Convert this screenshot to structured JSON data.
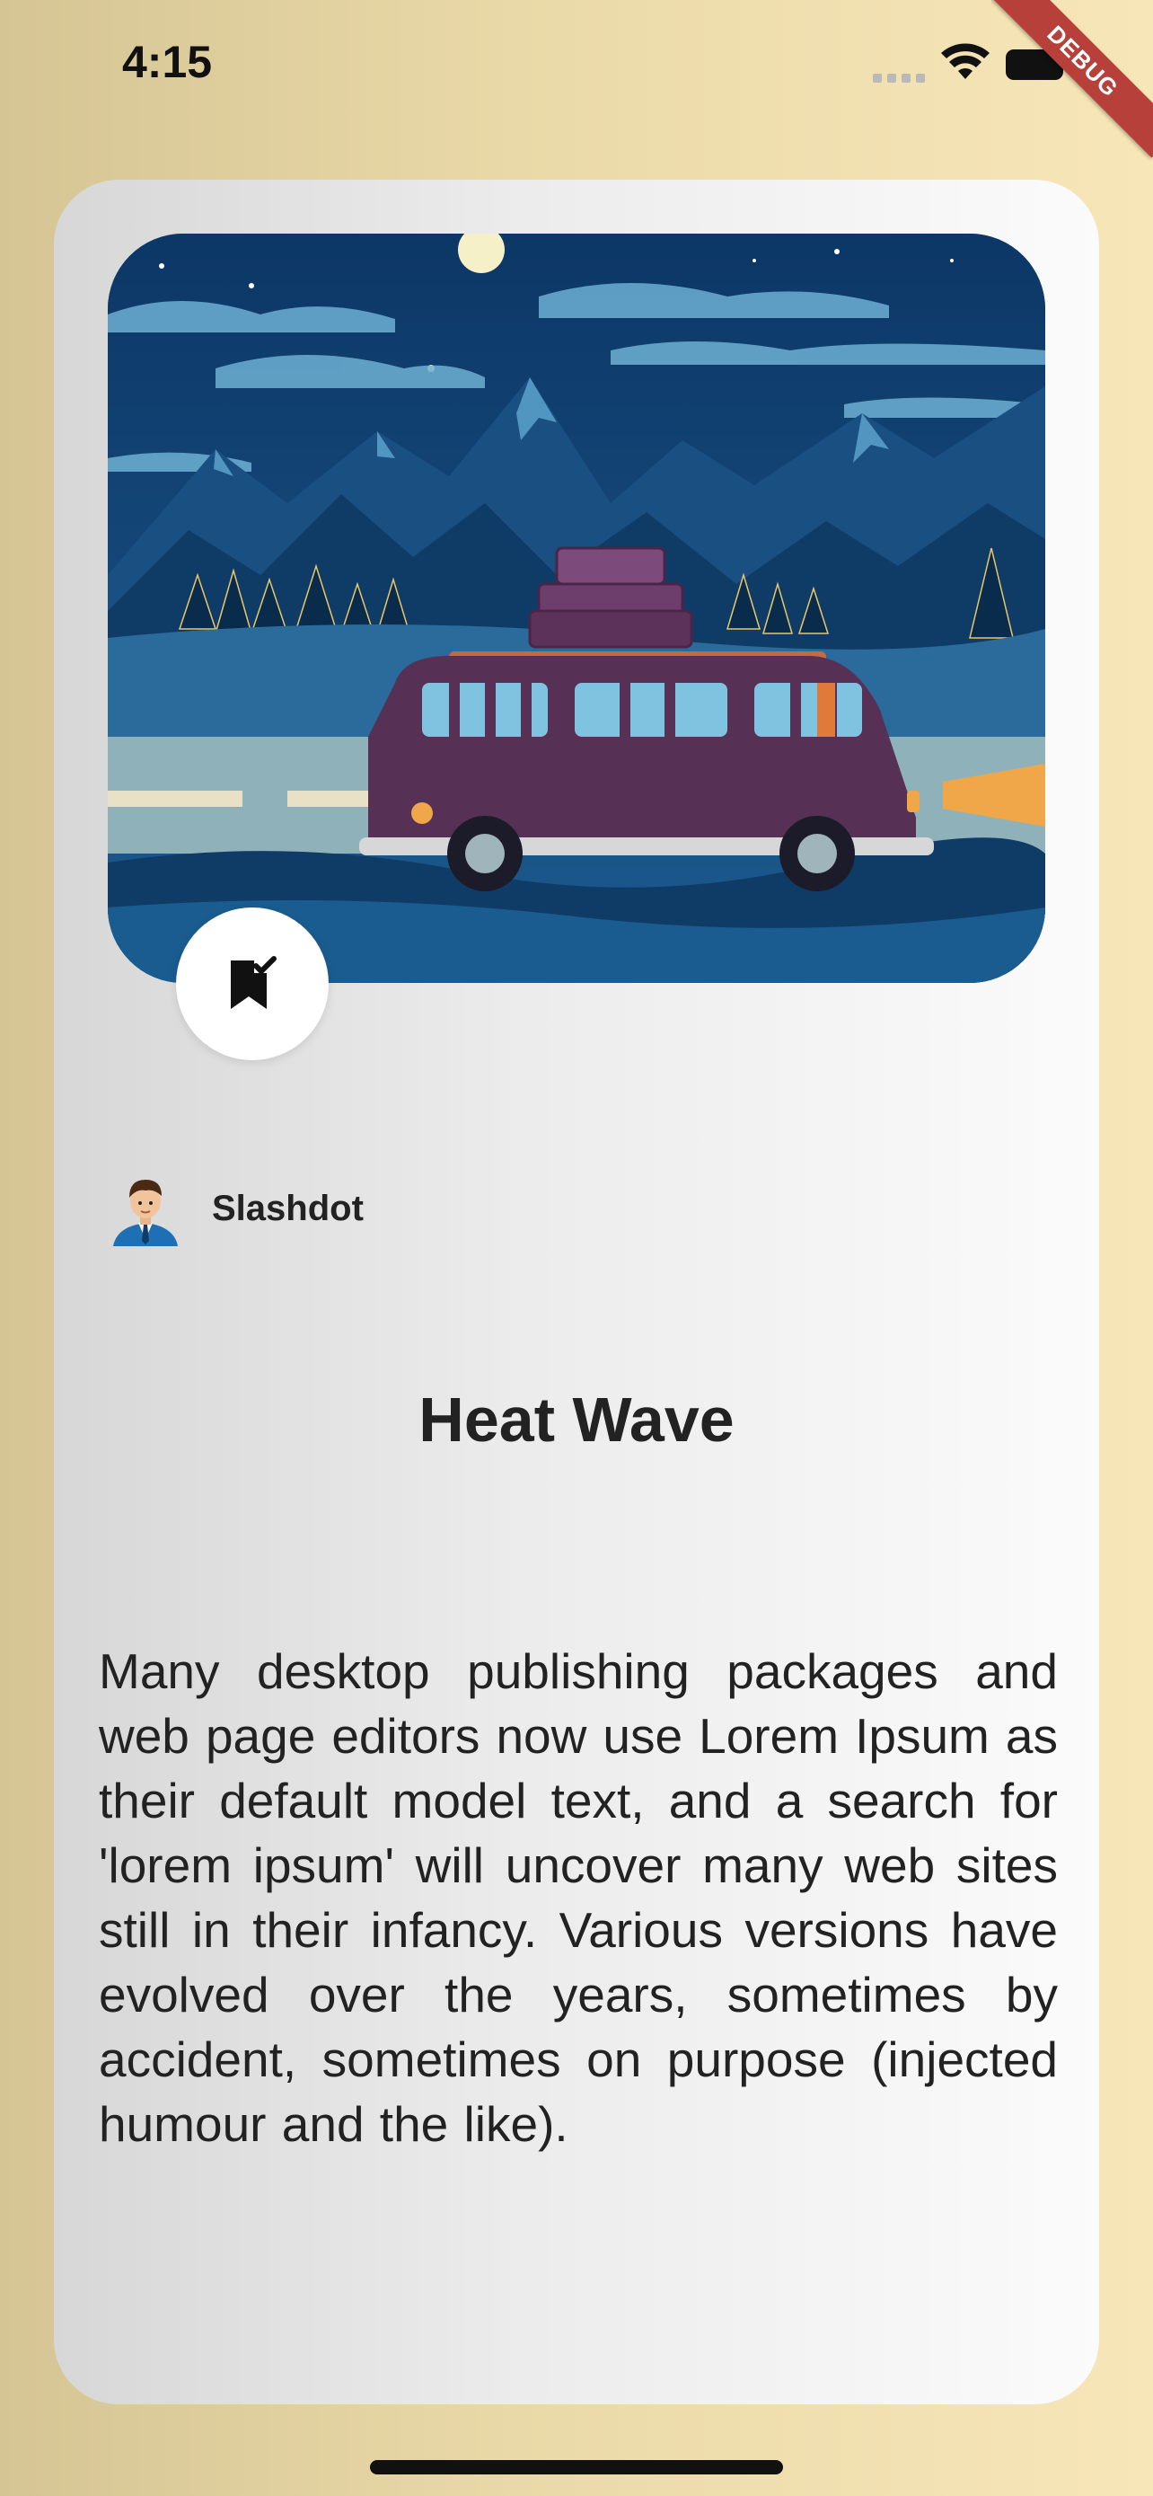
{
  "status_bar": {
    "time": "4:15",
    "icons": [
      "signal-icon",
      "wifi-icon",
      "battery-icon"
    ],
    "debug_label": "DEBUG"
  },
  "card": {
    "image": {
      "icon": "van-mountain-night-illustration"
    },
    "bookmark": {
      "icon": "bookmark-check-icon"
    },
    "author": {
      "name": "Slashdot",
      "avatar_icon": "man-avatar-icon"
    },
    "title": "Heat Wave",
    "body": "Many desktop publishing packages and web page editors now use Lorem Ipsum as their default model text, and a search for 'lorem ipsum' will uncover many web sites still in their infancy. Various versions have evolved over the years, sometimes by accident, sometimes on purpose (injected humour and the like)."
  },
  "colors": {
    "background_left": "#d6c594",
    "background_right": "#f7e6b8",
    "debug_ribbon": "#b7413a",
    "text": "#222222"
  }
}
